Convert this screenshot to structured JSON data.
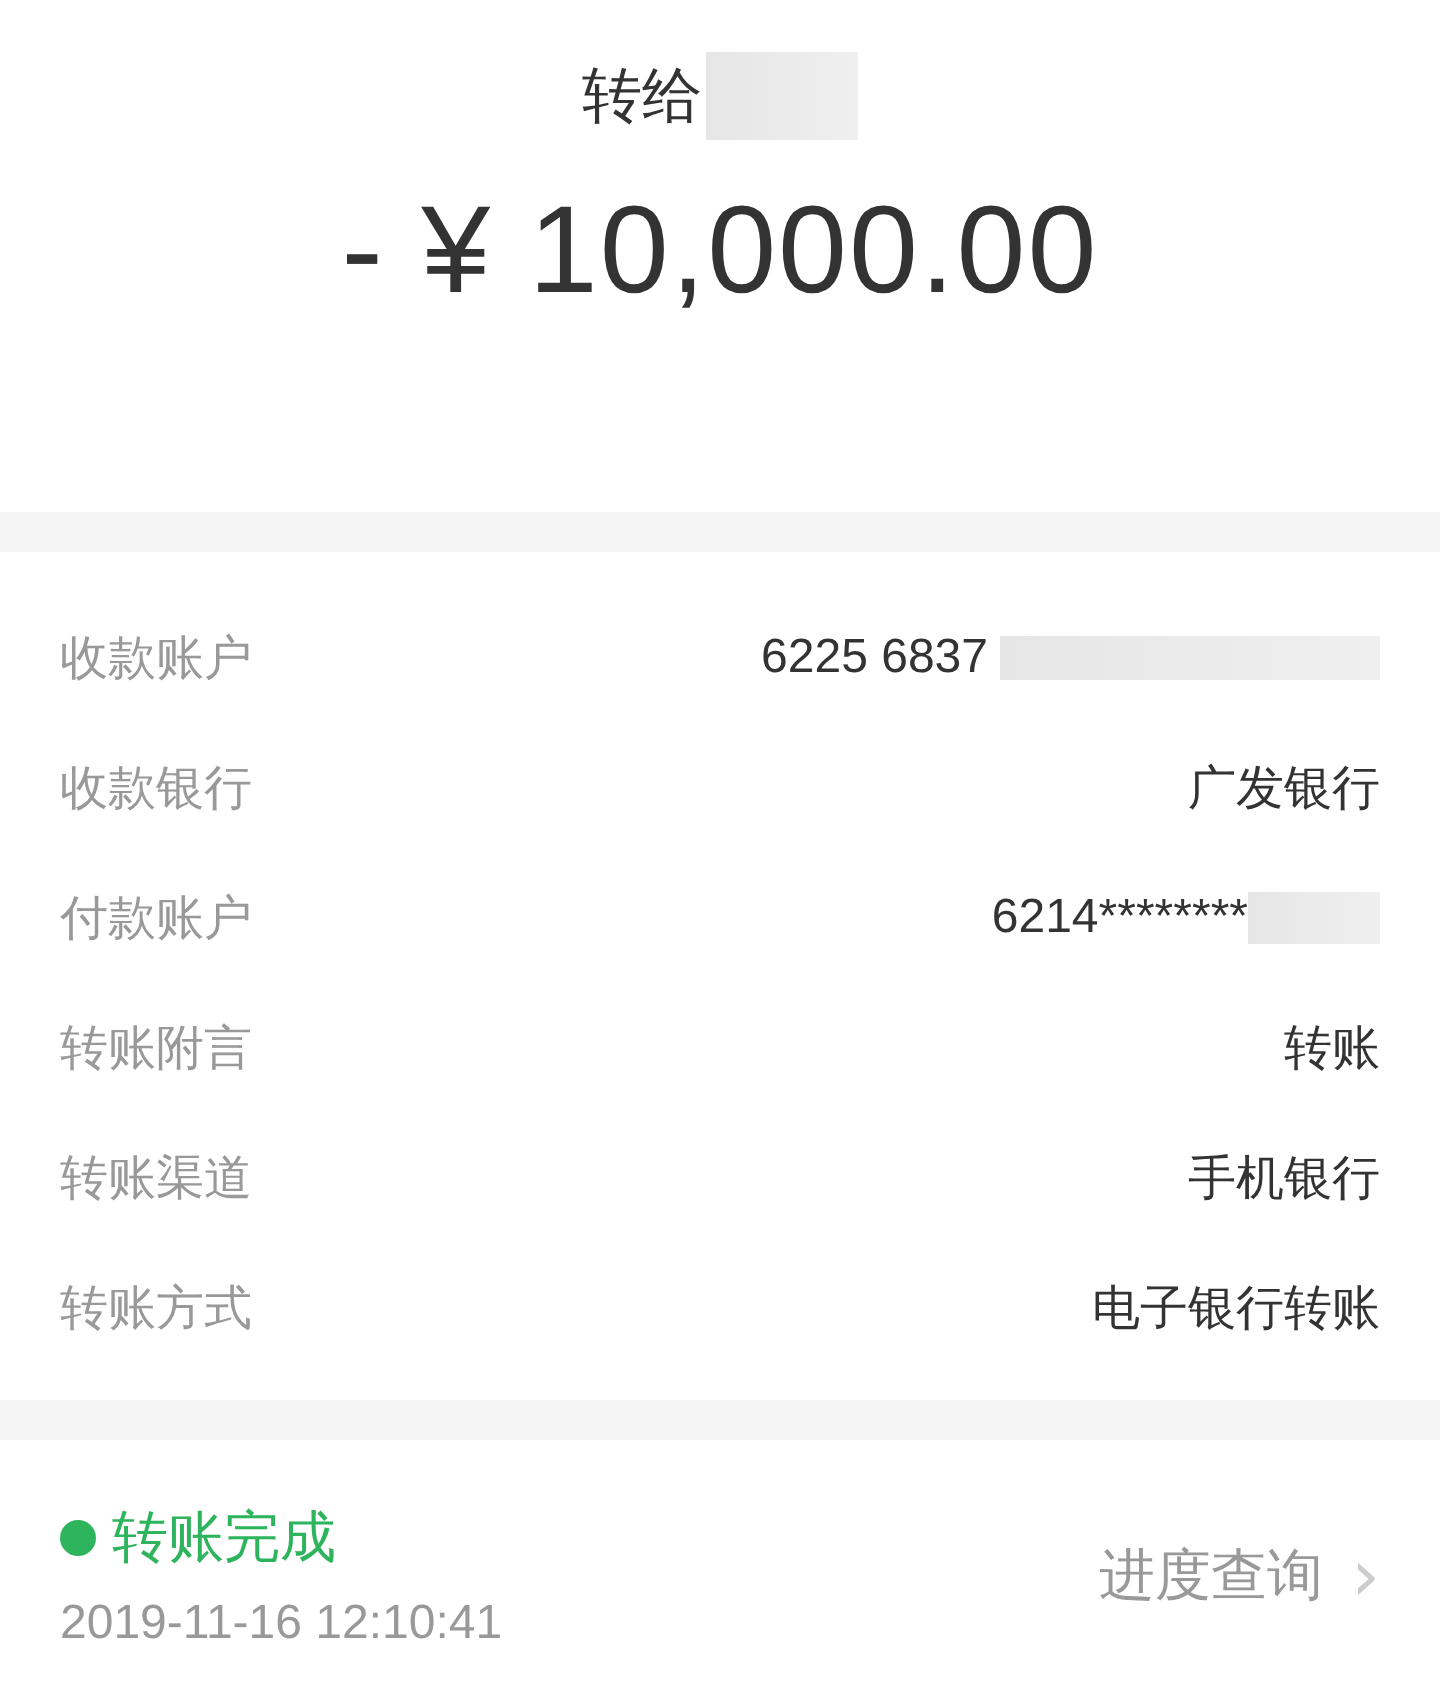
{
  "header": {
    "title": "转给",
    "title_redacted": true,
    "amount": "- ¥ 10,000.00"
  },
  "details": [
    {
      "label": "收款账户",
      "value": "6225 6837",
      "redacted": true
    },
    {
      "label": "收款银行",
      "value": "广发银行",
      "redacted": false
    },
    {
      "label": "付款账户",
      "value": "6214********",
      "redacted": true
    },
    {
      "label": "转账附言",
      "value": "转账",
      "redacted": false
    },
    {
      "label": "转账渠道",
      "value": "手机银行",
      "redacted": false
    },
    {
      "label": "转账方式",
      "value": "电子银行转账",
      "redacted": false
    }
  ],
  "status": {
    "text": "转账完成",
    "time": "2019-11-16 12:10:41",
    "link": "进度查询",
    "chevron": "›"
  }
}
